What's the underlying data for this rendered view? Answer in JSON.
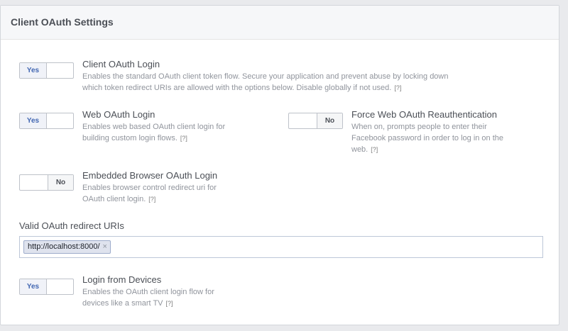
{
  "header": {
    "title": "Client OAuth Settings"
  },
  "help_text": "[?]",
  "settings": {
    "client_oauth_login": {
      "toggle": "Yes",
      "title": "Client OAuth Login",
      "desc_line1": "Enables the standard OAuth client token flow. Secure your application and prevent abuse by locking down",
      "desc_line2": "which token redirect URIs are allowed with the options below. Disable globally if not used."
    },
    "web_oauth_login": {
      "toggle": "Yes",
      "title": "Web OAuth Login",
      "desc_line1": "Enables web based OAuth client login for",
      "desc_line2": "building custom login flows."
    },
    "force_web_reauth": {
      "toggle": "No",
      "title": "Force Web OAuth Reauthentication",
      "desc_line1": "When on, prompts people to enter their",
      "desc_line2": "Facebook password in order to log in on the",
      "desc_line3": "web."
    },
    "embedded_browser_login": {
      "toggle": "No",
      "title": "Embedded Browser OAuth Login",
      "desc_line1": "Enables browser control redirect uri for",
      "desc_line2": "OAuth client login."
    },
    "login_from_devices": {
      "toggle": "Yes",
      "title": "Login from Devices",
      "desc_line1": "Enables the OAuth client login flow for",
      "desc_line2": "devices like a smart TV"
    }
  },
  "redirect_uris": {
    "label": "Valid OAuth redirect URIs",
    "tokens": [
      "http://localhost:8000/"
    ],
    "remove_glyph": "×"
  },
  "colors": {
    "accent_blue": "#4267b2",
    "header_bg": "#f6f7f9",
    "page_bg": "#e9eaed"
  }
}
